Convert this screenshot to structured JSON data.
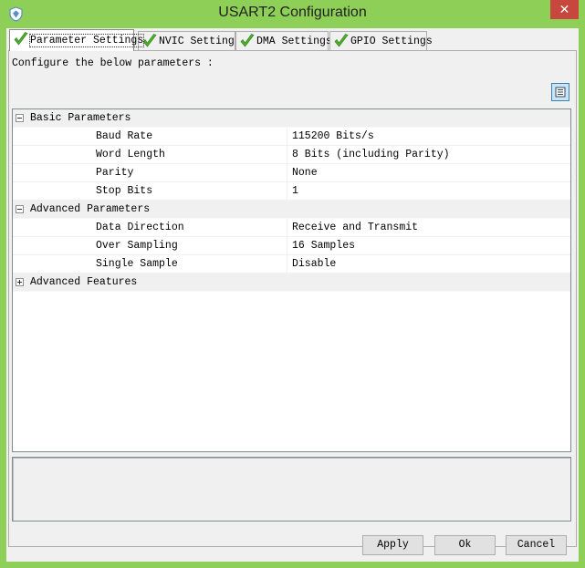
{
  "window": {
    "title": "USART2 Configuration",
    "close_label": "✕"
  },
  "tabs": [
    {
      "label": "Parameter Settings",
      "active": true
    },
    {
      "label": "NVIC Settings",
      "active": false
    },
    {
      "label": "DMA Settings",
      "active": false
    },
    {
      "label": "GPIO Settings",
      "active": false
    }
  ],
  "description": "Configure the below parameters :",
  "groups": [
    {
      "name": "Basic Parameters",
      "expanded": true,
      "params": [
        {
          "name": "Baud Rate",
          "value": "115200 Bits/s"
        },
        {
          "name": "Word Length",
          "value": "8 Bits (including Parity)"
        },
        {
          "name": "Parity",
          "value": "None"
        },
        {
          "name": "Stop Bits",
          "value": "1"
        }
      ]
    },
    {
      "name": "Advanced Parameters",
      "expanded": true,
      "params": [
        {
          "name": "Data Direction",
          "value": "Receive and Transmit"
        },
        {
          "name": "Over Sampling",
          "value": "16 Samples"
        },
        {
          "name": "Single Sample",
          "value": "Disable"
        }
      ]
    },
    {
      "name": "Advanced Features",
      "expanded": false,
      "params": []
    }
  ],
  "buttons": {
    "apply": "Apply",
    "ok": "Ok",
    "cancel": "Cancel"
  },
  "colors": {
    "titlebar": "#8ecf57",
    "close": "#c7463d",
    "check": "#4caf2a"
  }
}
